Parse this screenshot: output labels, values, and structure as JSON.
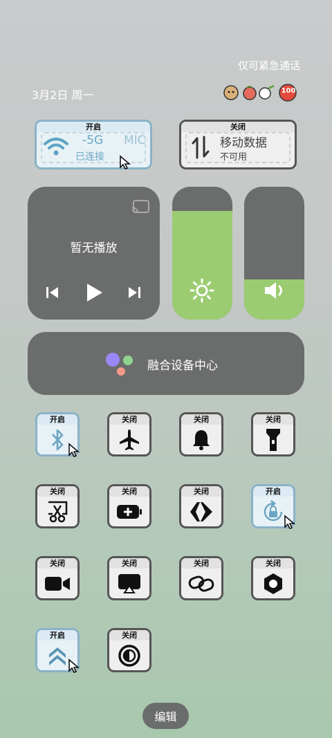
{
  "status_bar": {
    "emergency_text": "仅可紧急通话",
    "date": "3月2日 周一",
    "badge_text": "100"
  },
  "wifi_tile": {
    "state": "开启",
    "ssid_fragment": "-5G",
    "ssid_fragment2": "MIC",
    "status": "已连接"
  },
  "mobile_tile": {
    "state": "关闭",
    "title": "移动数据",
    "status": "不可用"
  },
  "media": {
    "label": "暂无播放"
  },
  "sliders": {
    "brightness_level": 0.82,
    "volume_level": 0.3
  },
  "device_center": {
    "label": "融合设备中心"
  },
  "toggles": [
    {
      "state": "开启",
      "icon": "bluetooth-icon"
    },
    {
      "state": "关闭",
      "icon": "airplane-icon"
    },
    {
      "state": "关闭",
      "icon": "bell-icon"
    },
    {
      "state": "关闭",
      "icon": "flashlight-icon"
    },
    {
      "state": "关闭",
      "icon": "screenshot-icon"
    },
    {
      "state": "关闭",
      "icon": "battery-saver-icon"
    },
    {
      "state": "关闭",
      "icon": "code-icon"
    },
    {
      "state": "开启",
      "icon": "rotation-lock-icon"
    },
    {
      "state": "关闭",
      "icon": "screen-record-icon"
    },
    {
      "state": "关闭",
      "icon": "screen-cast-icon"
    },
    {
      "state": "关闭",
      "icon": "link-icon"
    },
    {
      "state": "关闭",
      "icon": "settings-nut-icon"
    },
    {
      "state": "开启",
      "icon": "speed-boost-icon"
    },
    {
      "state": "关闭",
      "icon": "contrast-icon"
    }
  ],
  "edit_button": {
    "label": "编辑"
  },
  "colors": {
    "accent_green": "#9ccc72",
    "panel_dark": "#6b6d6c",
    "tile_on_border": "#8ab2c7"
  }
}
